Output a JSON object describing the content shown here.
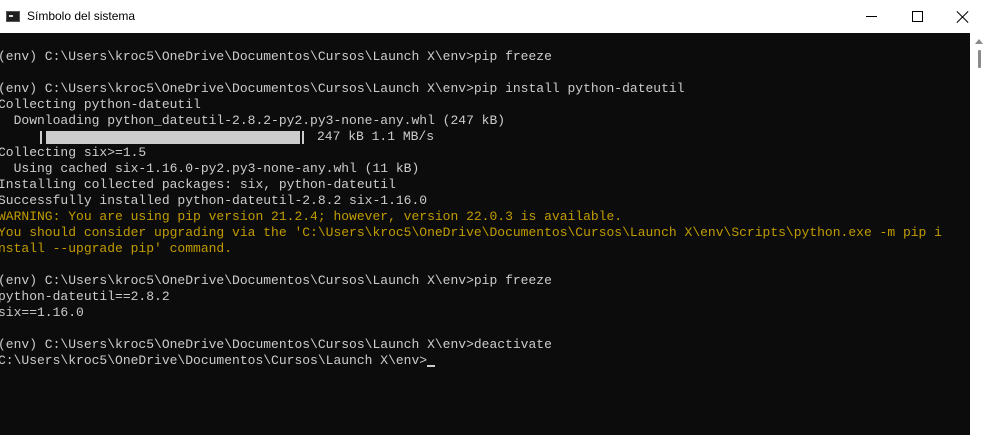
{
  "window": {
    "title": "Símbolo del sistema",
    "controls": {
      "minimize": "minimize",
      "maximize": "maximize",
      "close": "close"
    }
  },
  "console": {
    "lines": [
      "(env) C:\\Users\\kroc5\\OneDrive\\Documentos\\Cursos\\Launch X\\env>pip freeze",
      "",
      "(env) C:\\Users\\kroc5\\OneDrive\\Documentos\\Cursos\\Launch X\\env>pip install python-dateutil",
      "Collecting python-dateutil",
      "  Downloading python_dateutil-2.8.2-py2.py3-none-any.whl (247 kB)",
      "",
      "Collecting six>=1.5",
      "  Using cached six-1.16.0-py2.py3-none-any.whl (11 kB)",
      "Installing collected packages: six, python-dateutil",
      "Successfully installed python-dateutil-2.8.2 six-1.16.0",
      "WARNING: You are using pip version 21.2.4; however, version 22.0.3 is available.",
      "You should consider upgrading via the 'C:\\Users\\kroc5\\OneDrive\\Documentos\\Cursos\\Launch X\\env\\Scripts\\python.exe -m pip i",
      "nstall --upgrade pip' command.",
      "",
      "(env) C:\\Users\\kroc5\\OneDrive\\Documentos\\Cursos\\Launch X\\env>pip freeze",
      "python-dateutil==2.8.2",
      "six==1.16.0",
      "",
      "(env) C:\\Users\\kroc5\\OneDrive\\Documentos\\Cursos\\Launch X\\env>deactivate",
      "C:\\Users\\kroc5\\OneDrive\\Documentos\\Cursos\\Launch X\\env>"
    ],
    "progress": {
      "text": "247 kB 1.1 MB/s",
      "fraction": 1.0
    },
    "colors": {
      "text": "#cccccc",
      "warning": "#c19c00",
      "background": "#0c0c0c"
    }
  }
}
